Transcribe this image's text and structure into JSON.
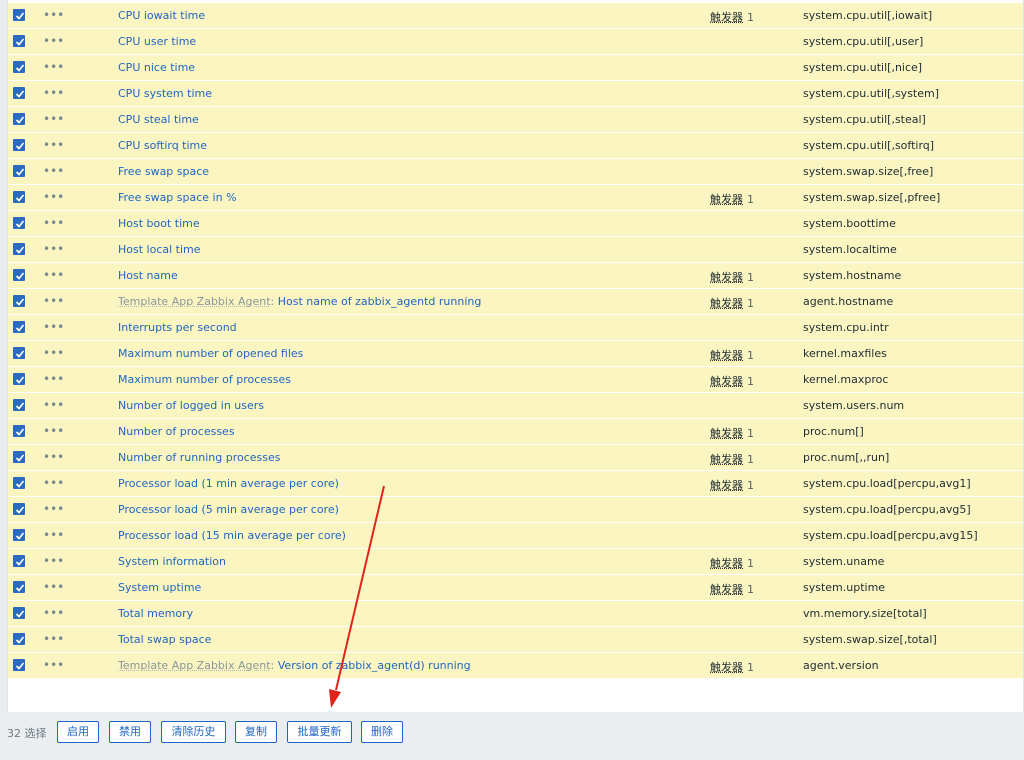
{
  "trigger_label": "触发器",
  "items": [
    {
      "prefix": "",
      "name": "CPU iowait time",
      "trigger_count": "1",
      "key": "system.cpu.util[,iowait]"
    },
    {
      "prefix": "",
      "name": "CPU user time",
      "trigger_count": "",
      "key": "system.cpu.util[,user]"
    },
    {
      "prefix": "",
      "name": "CPU nice time",
      "trigger_count": "",
      "key": "system.cpu.util[,nice]"
    },
    {
      "prefix": "",
      "name": "CPU system time",
      "trigger_count": "",
      "key": "system.cpu.util[,system]"
    },
    {
      "prefix": "",
      "name": "CPU steal time",
      "trigger_count": "",
      "key": "system.cpu.util[,steal]"
    },
    {
      "prefix": "",
      "name": "CPU softirq time",
      "trigger_count": "",
      "key": "system.cpu.util[,softirq]"
    },
    {
      "prefix": "",
      "name": "Free swap space",
      "trigger_count": "",
      "key": "system.swap.size[,free]"
    },
    {
      "prefix": "",
      "name": "Free swap space in %",
      "trigger_count": "1",
      "key": "system.swap.size[,pfree]"
    },
    {
      "prefix": "",
      "name": "Host boot time",
      "trigger_count": "",
      "key": "system.boottime"
    },
    {
      "prefix": "",
      "name": "Host local time",
      "trigger_count": "",
      "key": "system.localtime"
    },
    {
      "prefix": "",
      "name": "Host name",
      "trigger_count": "1",
      "key": "system.hostname"
    },
    {
      "prefix": "Template App Zabbix Agent",
      "name": "Host name of zabbix_agentd running",
      "trigger_count": "1",
      "key": "agent.hostname"
    },
    {
      "prefix": "",
      "name": "Interrupts per second",
      "trigger_count": "",
      "key": "system.cpu.intr"
    },
    {
      "prefix": "",
      "name": "Maximum number of opened files",
      "trigger_count": "1",
      "key": "kernel.maxfiles"
    },
    {
      "prefix": "",
      "name": "Maximum number of processes",
      "trigger_count": "1",
      "key": "kernel.maxproc"
    },
    {
      "prefix": "",
      "name": "Number of logged in users",
      "trigger_count": "",
      "key": "system.users.num"
    },
    {
      "prefix": "",
      "name": "Number of processes",
      "trigger_count": "1",
      "key": "proc.num[]"
    },
    {
      "prefix": "",
      "name": "Number of running processes",
      "trigger_count": "1",
      "key": "proc.num[,,run]"
    },
    {
      "prefix": "",
      "name": "Processor load (1 min average per core)",
      "trigger_count": "1",
      "key": "system.cpu.load[percpu,avg1]"
    },
    {
      "prefix": "",
      "name": "Processor load (5 min average per core)",
      "trigger_count": "",
      "key": "system.cpu.load[percpu,avg5]"
    },
    {
      "prefix": "",
      "name": "Processor load (15 min average per core)",
      "trigger_count": "",
      "key": "system.cpu.load[percpu,avg15]"
    },
    {
      "prefix": "",
      "name": "System information",
      "trigger_count": "1",
      "key": "system.uname"
    },
    {
      "prefix": "",
      "name": "System uptime",
      "trigger_count": "1",
      "key": "system.uptime"
    },
    {
      "prefix": "",
      "name": "Total memory",
      "trigger_count": "",
      "key": "vm.memory.size[total]"
    },
    {
      "prefix": "",
      "name": "Total swap space",
      "trigger_count": "",
      "key": "system.swap.size[,total]"
    },
    {
      "prefix": "Template App Zabbix Agent",
      "name": "Version of zabbix_agent(d) running",
      "trigger_count": "1",
      "key": "agent.version"
    }
  ],
  "footer": {
    "selected_text": "32 选择",
    "buttons": {
      "enable": "启用",
      "disable": "禁用",
      "clear_history": "清除历史",
      "copy": "复制",
      "mass_update": "批量更新",
      "delete": "删除"
    }
  },
  "colors": {
    "row_highlight": "#fbf6c1",
    "link": "#1f65c3",
    "checkbox": "#2a6bbf",
    "annotation_arrow": "#e0241c"
  },
  "icons": {
    "row_checkbox": "checkbox-checked-icon",
    "row_menu": "ellipsis-icon"
  }
}
